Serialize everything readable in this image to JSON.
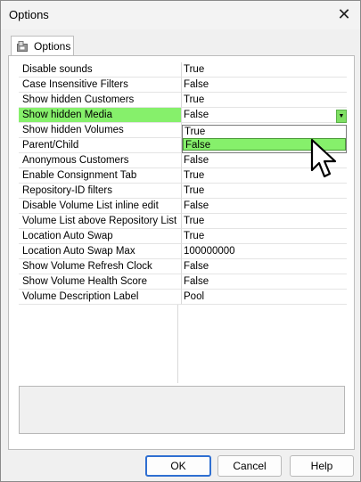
{
  "window": {
    "title": "Options",
    "close_glyph": "✕"
  },
  "tab": {
    "label": "Options",
    "icon": "options-tab-icon"
  },
  "properties": [
    {
      "name": "Disable sounds",
      "value": "True"
    },
    {
      "name": "Case Insensitive Filters",
      "value": "False"
    },
    {
      "name": "Show hidden Customers",
      "value": "True"
    },
    {
      "name": "Show hidden Media",
      "value": "False",
      "selected": true
    },
    {
      "name": "Show hidden Volumes",
      "value": ""
    },
    {
      "name": "Parent/Child",
      "value": ""
    },
    {
      "name": "Anonymous Customers",
      "value": "False"
    },
    {
      "name": "Enable Consignment Tab",
      "value": "True"
    },
    {
      "name": "Repository-ID filters",
      "value": "True"
    },
    {
      "name": "Disable Volume List inline edit",
      "value": "False"
    },
    {
      "name": "Volume List above Repository List",
      "value": "True"
    },
    {
      "name": "Location Auto Swap",
      "value": "True"
    },
    {
      "name": "Location Auto Swap Max",
      "value": "100000000"
    },
    {
      "name": "Show Volume Refresh Clock",
      "value": "False"
    },
    {
      "name": "Show Volume Health Score",
      "value": "False"
    },
    {
      "name": "Volume Description Label",
      "value": "Pool"
    }
  ],
  "dropdown": {
    "options": [
      "True",
      "False"
    ],
    "highlighted": "False",
    "button_glyph": "▼"
  },
  "buttons": {
    "ok": "OK",
    "cancel": "Cancel",
    "help": "Help"
  },
  "colors": {
    "selection": "#86f06b",
    "default_button_border": "#2f6fd1"
  }
}
